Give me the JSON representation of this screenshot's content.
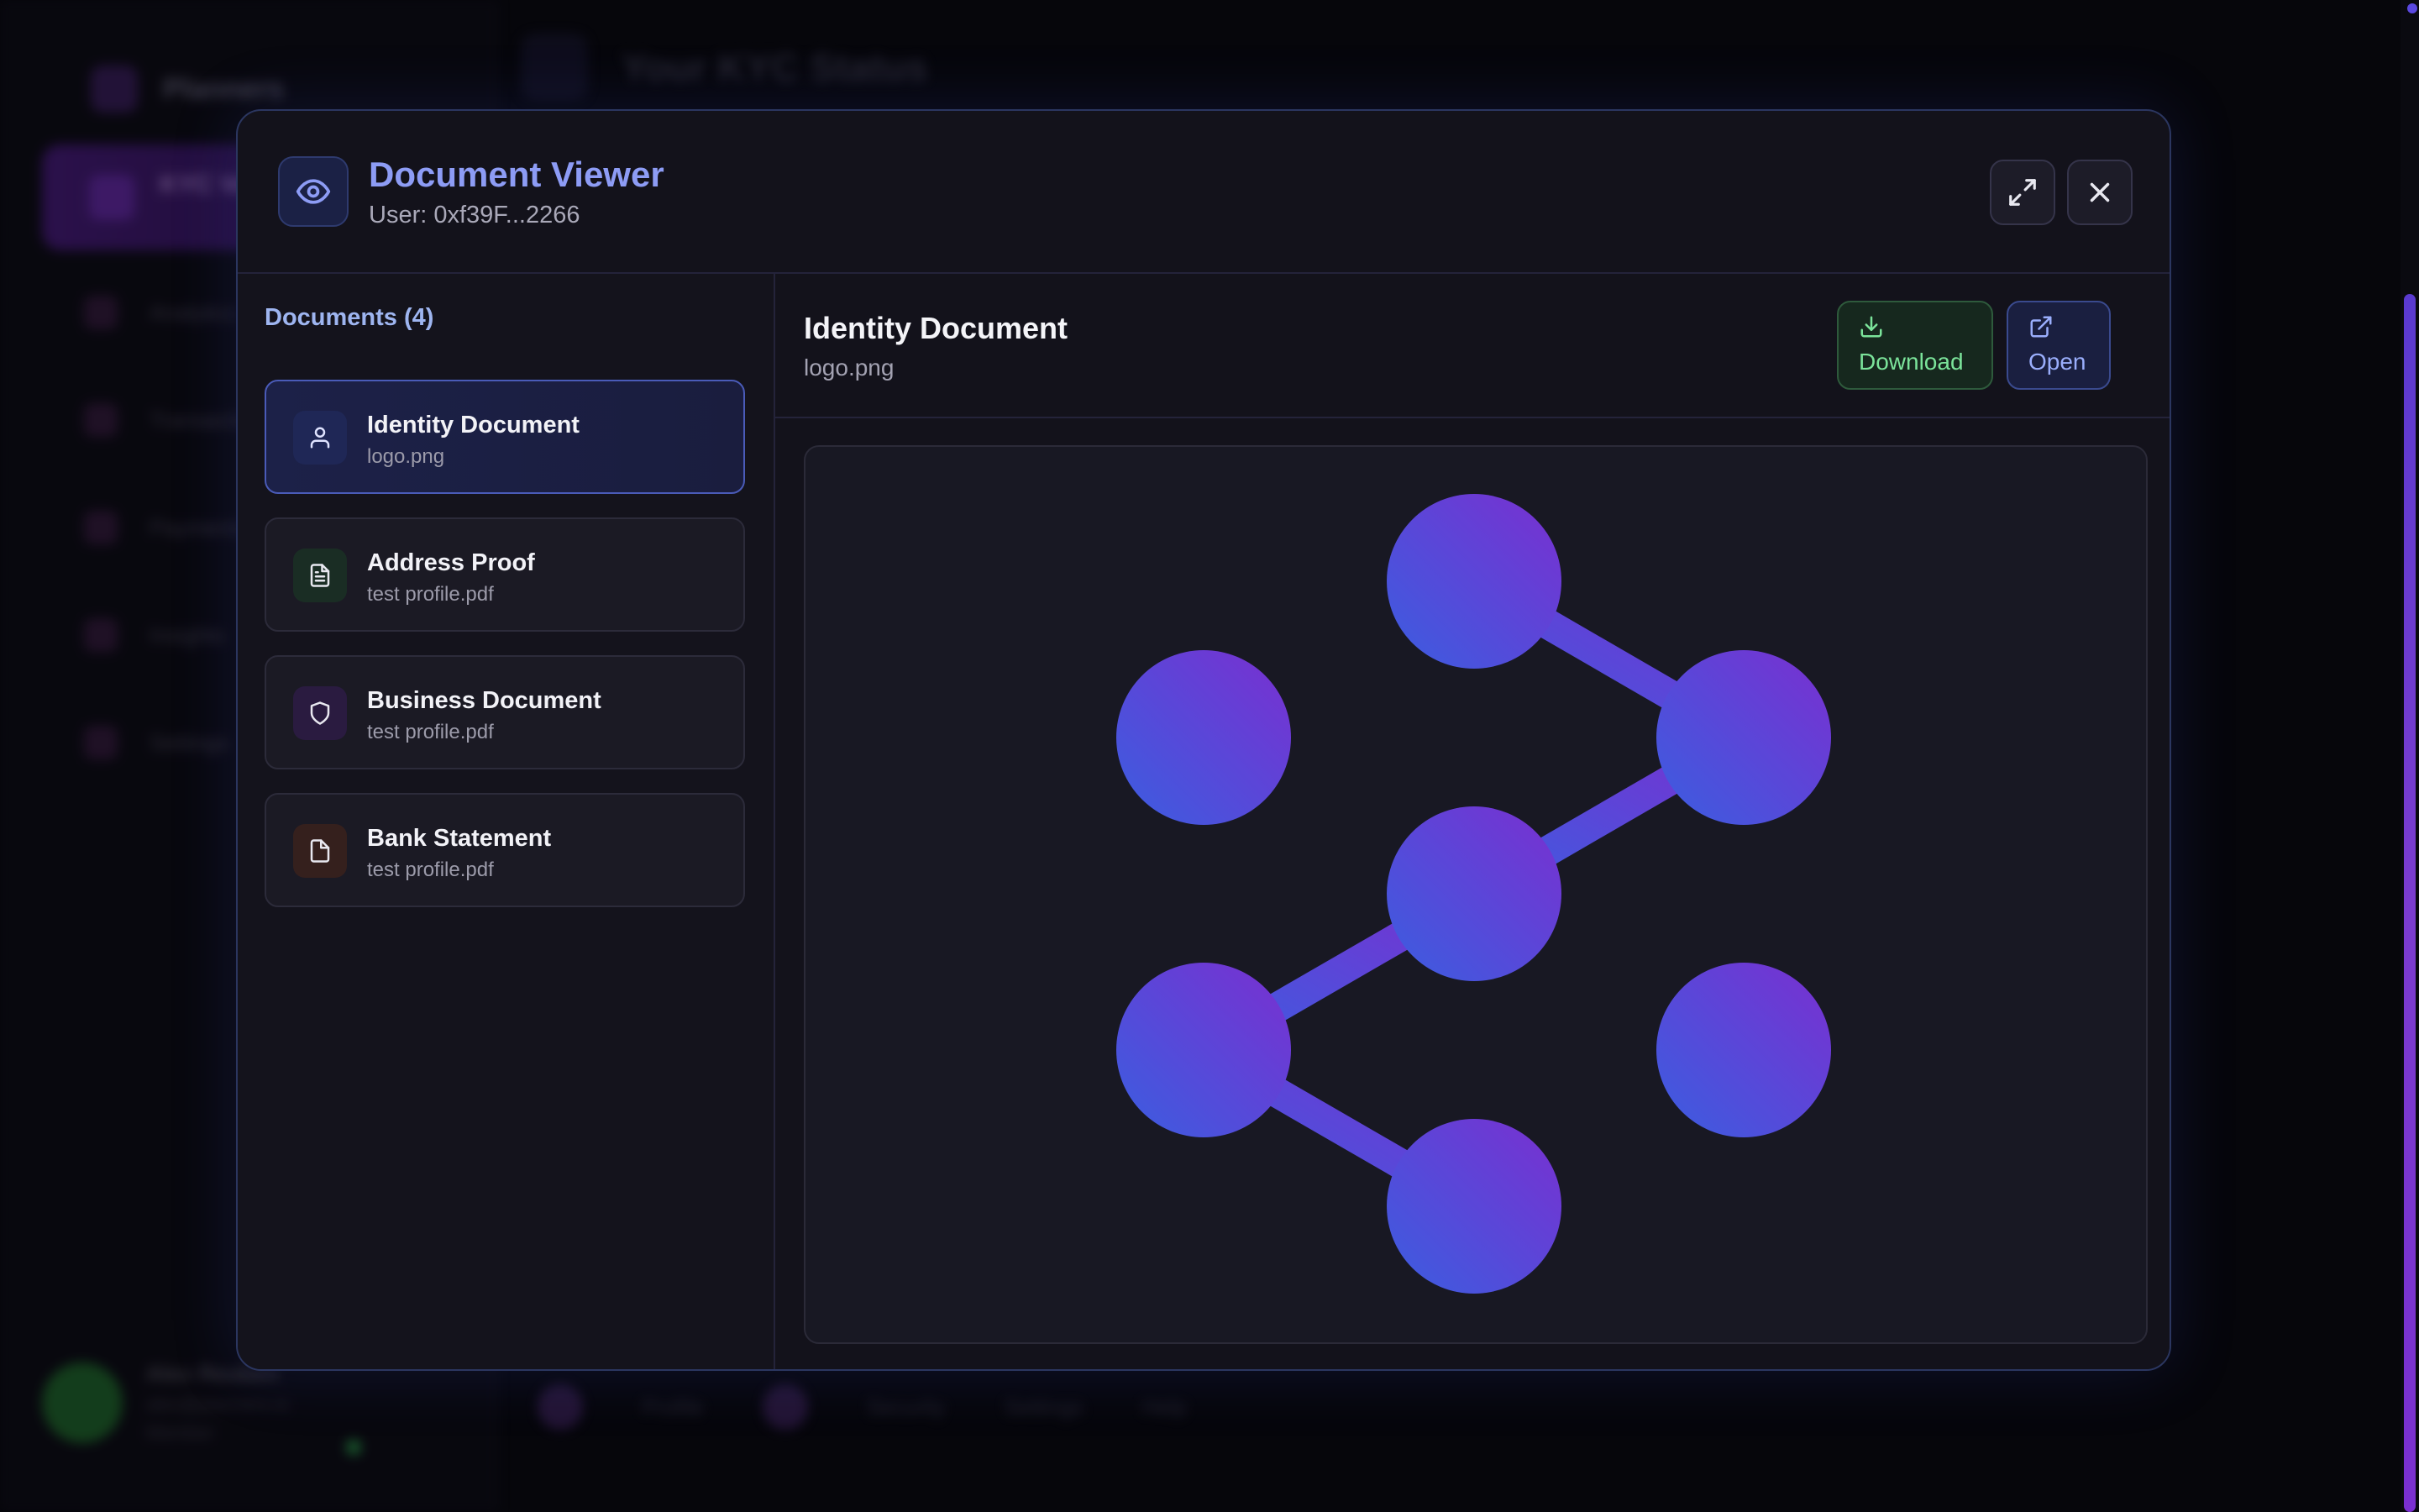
{
  "background": {
    "brand": "Planners",
    "page_title": "Your KYC Status",
    "active_nav": "KYC Verification",
    "nav_items": [
      "Analytics",
      "Transactions",
      "Payments",
      "Insights",
      "Settings"
    ],
    "user": {
      "name": "Alex Reuben",
      "sub": "alex@planners.io",
      "role": "Member"
    },
    "footer": [
      "Profile",
      "Security",
      "Settings",
      "Help"
    ]
  },
  "modal": {
    "title": "Document Viewer",
    "user": "User: 0xf39F...2266",
    "documents_title": "Documents (4)",
    "documents": [
      {
        "title": "Identity Document",
        "file": "logo.png",
        "icon": "user-icon",
        "color": "#1f2756",
        "active": true
      },
      {
        "title": "Address Proof",
        "file": "test profile.pdf",
        "icon": "file-text-icon",
        "color": "#1a2d24",
        "active": false
      },
      {
        "title": "Business Document",
        "file": "test profile.pdf",
        "icon": "shield-icon",
        "color": "#2a1b40",
        "active": false
      },
      {
        "title": "Bank Statement",
        "file": "test profile.pdf",
        "icon": "file-icon",
        "color": "#35201d",
        "active": false
      }
    ],
    "preview": {
      "title": "Identity Document",
      "file": "logo.png",
      "download_label": "Download",
      "open_label": "Open"
    }
  },
  "colors": {
    "accent": "#8d9cf5",
    "download": "#7be39a",
    "open": "#9aaefc",
    "logo_gradient": [
      "#3a5ee0",
      "#7a2fd0"
    ]
  }
}
